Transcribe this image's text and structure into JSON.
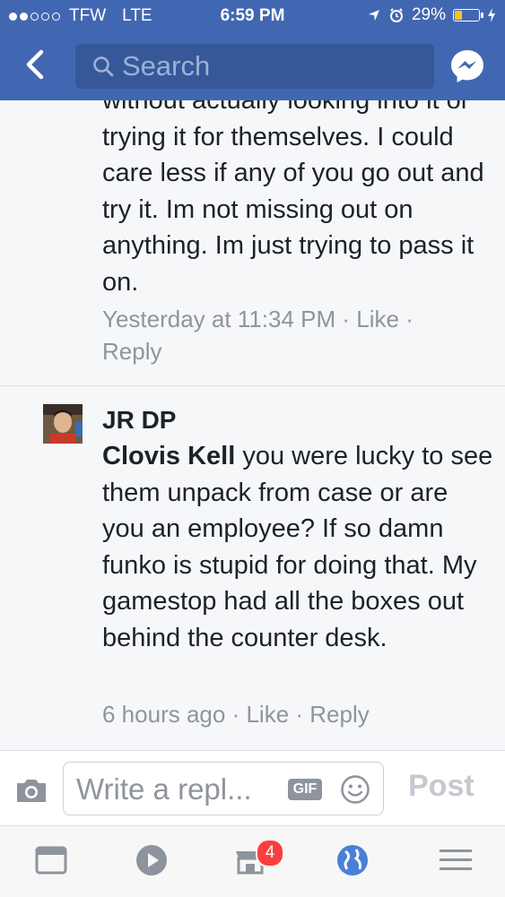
{
  "status_bar": {
    "carrier": "TFW",
    "network": "LTE",
    "time": "6:59 PM",
    "battery": "29%",
    "battery_level": 0.29,
    "signal_bars_filled": 2,
    "signal_bars_total": 5
  },
  "nav": {
    "search_placeholder": "Search",
    "icons": [
      "back-chevron-icon",
      "search-icon",
      "messenger-icon"
    ]
  },
  "comments": [
    {
      "lines_visible": "without actually looking into it or trying it for themselves. I could care less if any of you go out and try it. Im not missing out on anything.  Im just trying to pass it on.",
      "timestamp": "Yesterday at 11:34 PM",
      "like": "Like",
      "reply": "Reply"
    },
    {
      "author": "JR DP",
      "mention": "Clovis Kell",
      "text": " you were lucky to see them unpack from case or are you an employee? If so damn funko is stupid for doing that.  My gamestop had all the boxes out behind the counter desk.",
      "timestamp": "6 hours ago",
      "like": "Like",
      "reply": "Reply"
    }
  ],
  "reply_bar": {
    "placeholder": "Write a repl...",
    "gif_label": "GIF",
    "post_label": "Post",
    "icons": [
      "camera-icon",
      "smiley-icon"
    ]
  },
  "tab_bar": {
    "notification_badge": "4",
    "tabs": [
      "news-feed-icon",
      "video-play-icon",
      "marketplace-icon",
      "notifications-globe-icon",
      "menu-icon"
    ]
  },
  "colors": {
    "brand_blue": "#4267b2",
    "search_bg": "#365899",
    "meta_gray": "#90949c",
    "badge_red": "#fa3e3e",
    "battery_yellow": "#f5c518"
  }
}
